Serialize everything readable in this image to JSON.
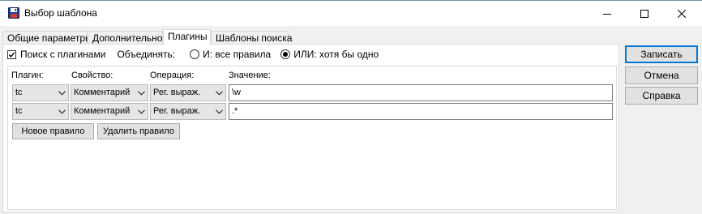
{
  "window": {
    "title": "Выбор шаблона",
    "icon": "floppy-disk-icon",
    "controls": [
      "minimize-icon",
      "maximize-icon",
      "close-icon"
    ]
  },
  "tabs": [
    {
      "label": "Общие параметры",
      "active": false
    },
    {
      "label": "Дополнительно",
      "active": false
    },
    {
      "label": "Плагины",
      "active": true
    },
    {
      "label": "Шаблоны поиска",
      "active": false
    }
  ],
  "plugins": {
    "search_with_plugins": {
      "label": "Поиск с плагинами",
      "checked": true
    },
    "combine_label": "Объединять:",
    "combine_options": [
      {
        "label": "И: все правила",
        "selected": false
      },
      {
        "label": "ИЛИ: хотя бы одно",
        "selected": true
      }
    ],
    "columns": {
      "plugin": "Плагин:",
      "property": "Свойство:",
      "operation": "Операция:",
      "value": "Значение:"
    },
    "rules": [
      {
        "plugin": "tc",
        "property": "Комментарий",
        "operation": "Рег. выраж.",
        "value": "\\w"
      },
      {
        "plugin": "tc",
        "property": "Комментарий",
        "operation": "Рег. выраж.",
        "value": ".*"
      }
    ],
    "new_rule_button": "Новое правило",
    "delete_rule_button": "Удалить правило"
  },
  "buttons": {
    "save": "Записать",
    "cancel": "Отмена",
    "help": "Справка"
  },
  "colors": {
    "default_button_border": "#0078d7",
    "window_background": "#f0f0f0"
  }
}
